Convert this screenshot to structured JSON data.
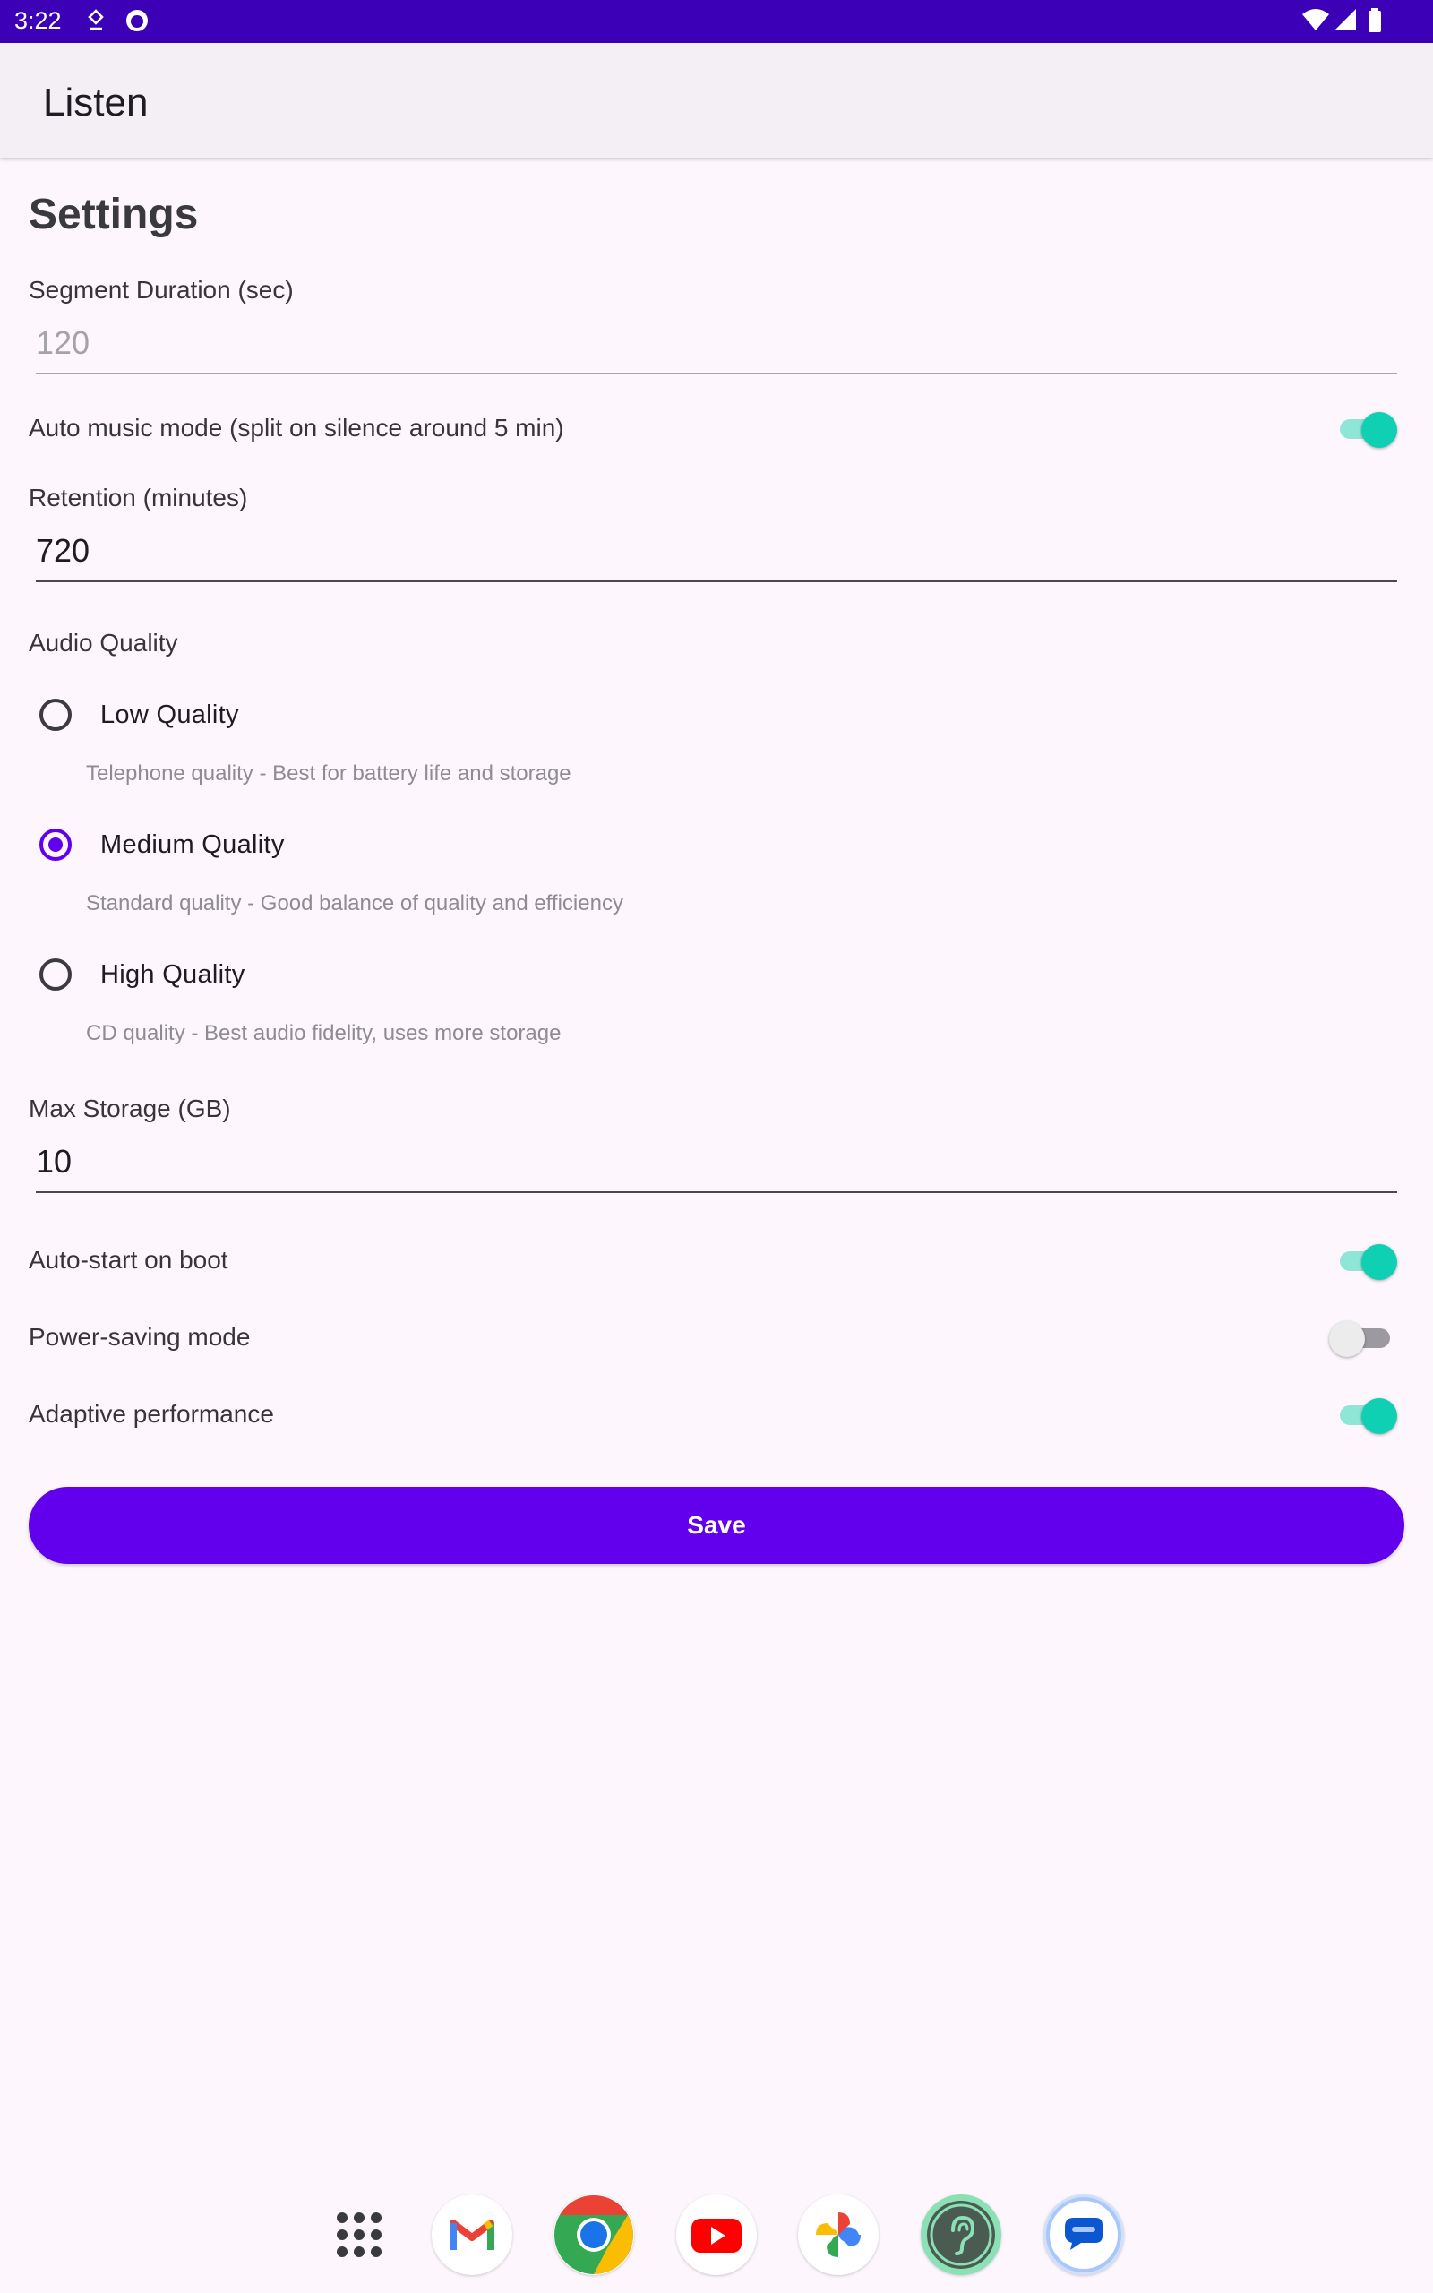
{
  "status_bar": {
    "time": "3:22"
  },
  "app_bar": {
    "title": "Listen"
  },
  "settings": {
    "heading": "Settings",
    "segment_duration": {
      "label": "Segment Duration (sec)",
      "value": "120"
    },
    "auto_music_mode": {
      "label": "Auto music mode (split on silence around 5 min)",
      "enabled": true
    },
    "retention": {
      "label": "Retention (minutes)",
      "value": "720"
    },
    "audio_quality": {
      "label": "Audio Quality",
      "selected": "Medium Quality",
      "options": [
        {
          "label": "Low Quality",
          "description": "Telephone quality - Best for battery life and storage"
        },
        {
          "label": "Medium Quality",
          "description": "Standard quality - Good balance of quality and efficiency"
        },
        {
          "label": "High Quality",
          "description": "CD quality - Best audio fidelity, uses more storage"
        }
      ]
    },
    "max_storage": {
      "label": "Max Storage (GB)",
      "value": "10"
    },
    "auto_start": {
      "label": "Auto-start on boot",
      "enabled": true
    },
    "power_saving": {
      "label": "Power-saving mode",
      "enabled": false
    },
    "adaptive_performance": {
      "label": "Adaptive performance",
      "enabled": true
    },
    "save_label": "Save"
  },
  "dock": {
    "apps": [
      "app-drawer-icon",
      "gmail-icon",
      "chrome-icon",
      "youtube-icon",
      "photos-icon",
      "listen-app-icon",
      "messages-icon"
    ]
  },
  "colors": {
    "status_bar": "#3c00b6",
    "accent": "#6200ee",
    "switch_on": "#10d0b3",
    "background": "#fdf7fd"
  }
}
